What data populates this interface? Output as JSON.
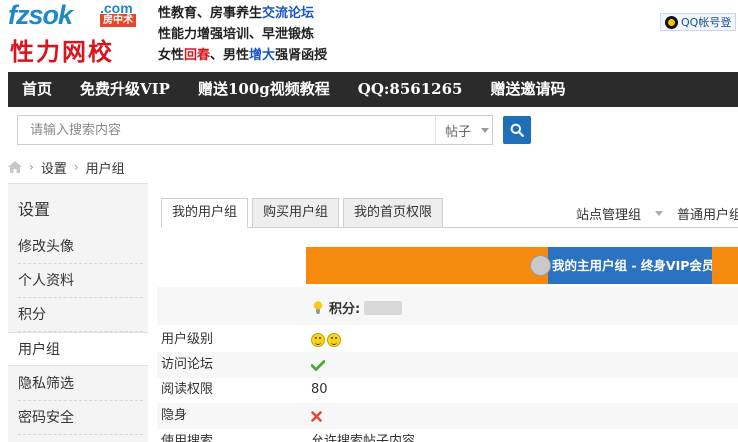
{
  "header": {
    "logo_en": "fzsok",
    "logo_com": ".com",
    "logo_badge": "房中术",
    "logo_cn": "性力网校",
    "slogans": [
      {
        "parts": [
          {
            "t": "性教育、房事养生",
            "c": "normal"
          },
          {
            "t": "交流论坛",
            "c": "blue"
          }
        ]
      },
      {
        "parts": [
          {
            "t": "性能力增强培训、早泄锻炼",
            "c": "normal"
          }
        ]
      },
      {
        "parts": [
          {
            "t": "女性",
            "c": "normal"
          },
          {
            "t": "回春",
            "c": "red"
          },
          {
            "t": "、男性",
            "c": "normal"
          },
          {
            "t": "增大",
            "c": "blue"
          },
          {
            "t": "强肾函授",
            "c": "normal"
          }
        ]
      }
    ],
    "qq_login": "QQ帐号登"
  },
  "nav": {
    "items": [
      "首页",
      "免费升级VIP",
      "赠送100g视频教程",
      "QQ:8561265",
      "赠送邀请码"
    ]
  },
  "search": {
    "placeholder": "请输入搜索内容",
    "type": "帖子"
  },
  "breadcrumb": {
    "items": [
      "设置",
      "用户组"
    ]
  },
  "sidebar": {
    "title": "设置",
    "items": [
      "修改头像",
      "个人资料",
      "积分",
      "用户组",
      "隐私筛选",
      "密码安全"
    ],
    "active_index": 3
  },
  "tabs": {
    "items": [
      "我的用户组",
      "购买用户组",
      "我的首页权限"
    ],
    "active_index": 0
  },
  "right_links": {
    "admin": "站点管理组",
    "normal": "普通用户组"
  },
  "banner": {
    "text": "我的主用户组 - 终身VIP会员"
  },
  "score": {
    "label": "积分:"
  },
  "info_rows": [
    {
      "label": "用户级别",
      "value_type": "smiles",
      "value": ""
    },
    {
      "label": "访问论坛",
      "value_type": "check-icon",
      "value": ""
    },
    {
      "label": "阅读权限",
      "value_type": "text",
      "value": "80"
    },
    {
      "label": "隐身",
      "value_type": "cross-icon",
      "value": ""
    },
    {
      "label": "使用搜索",
      "value_type": "text",
      "value": "允许搜索帖子内容"
    }
  ],
  "colors": {
    "nav_bg": "#2b2b2b",
    "banner_orange": "#f58a0f",
    "banner_blue": "#2b73c0",
    "search_btn": "#1d6fb7",
    "logo_blue": "#1e88c8",
    "logo_red": "#d9141c"
  }
}
